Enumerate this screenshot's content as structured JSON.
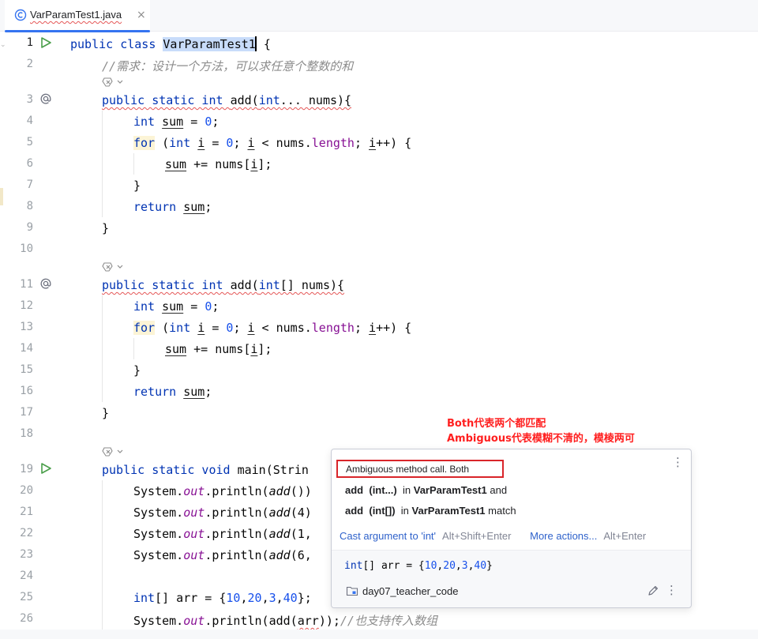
{
  "tab": {
    "title": "VarParamTest1.java",
    "close": "×"
  },
  "gutter_lines": [
    "1",
    "2",
    "3",
    "4",
    "5",
    "6",
    "7",
    "8",
    "9",
    "10",
    "11",
    "12",
    "13",
    "14",
    "15",
    "16",
    "17",
    "18",
    "19",
    "20",
    "21",
    "22",
    "23",
    "24",
    "25",
    "26"
  ],
  "code": {
    "l1_kw": "public class ",
    "l1_name": "VarParamTest1",
    "l1_tail": " {",
    "l2": "//需求：设计一个方法，可以求任意个整数的和",
    "l3_mods": "public static int ",
    "l3_name": "add",
    "l3_open": "(",
    "l3_type": "int",
    "l3_rest": "... nums){",
    "l4_kw": "int ",
    "l4_var": "sum",
    "l4_mid": " = ",
    "l4_num": "0",
    "l4_end": ";",
    "l5_kw": "for",
    "l5_a": " (",
    "l5_int": "int ",
    "l5_i1": "i",
    "l5_b": " = ",
    "l5_zero": "0",
    "l5_c": "; ",
    "l5_i2": "i",
    "l5_d": " < nums.",
    "l5_len": "length",
    "l5_e": "; ",
    "l5_i3": "i",
    "l5_f": "++) {",
    "l6_sum": "sum",
    "l6_mid": " += nums[",
    "l6_i": "i",
    "l6_end": "];",
    "l7": "}",
    "l8_kw": "return ",
    "l8_sum": "sum",
    "l8_end": ";",
    "l9": "}",
    "l11_mods": "public static int ",
    "l11_name": "add",
    "l11_open": "(",
    "l11_type": "int",
    "l11_rest": "[] nums){",
    "l12_kw": "int ",
    "l12_var": "sum",
    "l12_mid": " = ",
    "l12_num": "0",
    "l12_end": ";",
    "l13_kw": "for",
    "l13_a": " (",
    "l13_int": "int ",
    "l13_i1": "i",
    "l13_b": " = ",
    "l13_zero": "0",
    "l13_c": "; ",
    "l13_i2": "i",
    "l13_d": " < nums.",
    "l13_len": "length",
    "l13_e": "; ",
    "l13_i3": "i",
    "l13_f": "++) {",
    "l14_sum": "sum",
    "l14_mid": " += nums[",
    "l14_i": "i",
    "l14_end": "];",
    "l15": "}",
    "l16_kw": "return ",
    "l16_sum": "sum",
    "l16_end": ";",
    "l17": "}",
    "l19_kw": "public static void ",
    "l19_name": "main",
    "l19_rest": "(Strin",
    "l20_sys": "System.",
    "l20_out": "out",
    "l20_mid": ".println(",
    "l20_add": "add",
    "l20_rest": "())",
    "l21_sys": "System.",
    "l21_out": "out",
    "l21_mid": ".println(",
    "l21_add": "add",
    "l21_rest": "(4)",
    "l22_sys": "System.",
    "l22_out": "out",
    "l22_mid": ".println(",
    "l22_add": "add",
    "l22_rest": "(1,",
    "l23_sys": "System.",
    "l23_out": "out",
    "l23_mid": ".println(",
    "l23_add": "add",
    "l23_rest": "(6,",
    "l25_kw": "int",
    "l25_a": "[] arr = {",
    "l25_n1": "10",
    "l25_c1": ",",
    "l25_n2": "20",
    "l25_c2": ",",
    "l25_n3": "3",
    "l25_c3": ",",
    "l25_n4": "40",
    "l25_end": "};",
    "l26_sys": "System.",
    "l26_out": "out",
    "l26_mid": ".println(add(",
    "l26_arr": "arr",
    "l26_end": "));",
    "l26_cm": "//也支持传入数组"
  },
  "annotation": {
    "line1": "Both代表两个都匹配",
    "line2": "Ambiguous代表模糊不清的，模棱两可"
  },
  "popup": {
    "header": "Ambiguous method call. Both",
    "row1_method": "add",
    "row1_sig": "(int...)",
    "row1_in": "in",
    "row1_class": "VarParamTest1",
    "row1_tail": "and",
    "row2_method": "add",
    "row2_sig": "(int[])",
    "row2_in": "in",
    "row2_class": "VarParamTest1",
    "row2_tail": "match",
    "action1": "Cast argument to 'int'",
    "action1_shortcut": "Alt+Shift+Enter",
    "action2": "More actions...",
    "action2_shortcut": "Alt+Enter",
    "code_kw": "int",
    "code_a": "[] arr = {",
    "code_n1": "10",
    "code_c1": ",",
    "code_n2": "20",
    "code_c2": ",",
    "code_n3": "3",
    "code_c3": ",",
    "code_n4": "40",
    "code_end": "}",
    "module": "day07_teacher_code",
    "kebab": "⋮"
  },
  "colors": {
    "keyword": "#0033b3",
    "number": "#1750eb",
    "field": "#871094",
    "comment": "#8c8c8c",
    "annotation": "#ff1f1f",
    "link": "#2f62cb",
    "accent": "#3574f0"
  },
  "icons": [
    "java-class-icon",
    "run-gutter-icon",
    "override-gutter-icon",
    "ai-assist-icon",
    "module-folder-icon",
    "edit-pencil-icon",
    "more-kebab-icon"
  ]
}
